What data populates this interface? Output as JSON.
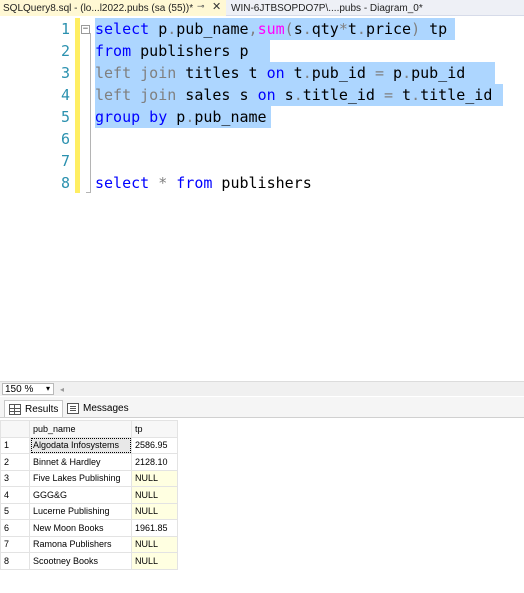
{
  "tabs": [
    {
      "label": "SQLQuery8.sql - (lo...l2022.pubs (sa (55))*",
      "pin": "⊸",
      "close": "✕",
      "active": true
    },
    {
      "label": "WIN-6JTBSOPDO7P\\....pubs - Diagram_0*",
      "active": false
    }
  ],
  "editor": {
    "line_numbers": [
      "1",
      "2",
      "3",
      "4",
      "5",
      "6",
      "7",
      "8"
    ],
    "fold_glyph": "−",
    "lines": [
      [
        {
          "t": "select",
          "c": "kw"
        },
        {
          "t": " p",
          "c": "tx"
        },
        {
          "t": ".",
          "c": "gr"
        },
        {
          "t": "pub_name",
          "c": "tx"
        },
        {
          "t": ",",
          "c": "gr"
        },
        {
          "t": "sum",
          "c": "fn"
        },
        {
          "t": "(",
          "c": "gr"
        },
        {
          "t": "s",
          "c": "tx"
        },
        {
          "t": ".",
          "c": "gr"
        },
        {
          "t": "qty",
          "c": "tx"
        },
        {
          "t": "*",
          "c": "gr"
        },
        {
          "t": "t",
          "c": "tx"
        },
        {
          "t": ".",
          "c": "gr"
        },
        {
          "t": "price",
          "c": "tx"
        },
        {
          "t": ")",
          "c": "gr"
        },
        {
          "t": " tp",
          "c": "tx"
        }
      ],
      [
        {
          "t": "from",
          "c": "kw"
        },
        {
          "t": " publishers p",
          "c": "tx"
        }
      ],
      [
        {
          "t": "left join",
          "c": "gr"
        },
        {
          "t": " titles t ",
          "c": "tx"
        },
        {
          "t": "on",
          "c": "kw"
        },
        {
          "t": " t",
          "c": "tx"
        },
        {
          "t": ".",
          "c": "gr"
        },
        {
          "t": "pub_id ",
          "c": "tx"
        },
        {
          "t": "=",
          "c": "gr"
        },
        {
          "t": " p",
          "c": "tx"
        },
        {
          "t": ".",
          "c": "gr"
        },
        {
          "t": "pub_id",
          "c": "tx"
        }
      ],
      [
        {
          "t": "left join",
          "c": "gr"
        },
        {
          "t": " sales s ",
          "c": "tx"
        },
        {
          "t": "on",
          "c": "kw"
        },
        {
          "t": " s",
          "c": "tx"
        },
        {
          "t": ".",
          "c": "gr"
        },
        {
          "t": "title_id ",
          "c": "tx"
        },
        {
          "t": "=",
          "c": "gr"
        },
        {
          "t": " t",
          "c": "tx"
        },
        {
          "t": ".",
          "c": "gr"
        },
        {
          "t": "title_id",
          "c": "tx"
        }
      ],
      [
        {
          "t": "group by",
          "c": "kw"
        },
        {
          "t": " p",
          "c": "tx"
        },
        {
          "t": ".",
          "c": "gr"
        },
        {
          "t": "pub_name",
          "c": "tx"
        }
      ],
      [],
      [],
      [
        {
          "t": "select",
          "c": "kw"
        },
        {
          "t": " ",
          "c": "tx"
        },
        {
          "t": "*",
          "c": "gr"
        },
        {
          "t": " ",
          "c": "tx"
        },
        {
          "t": "from",
          "c": "kw"
        },
        {
          "t": " publishers",
          "c": "tx"
        }
      ]
    ]
  },
  "zoom": {
    "value": "150 %",
    "arrow": "▾",
    "scroll_left": "◂"
  },
  "results_tabs": {
    "results_label": "Results",
    "messages_label": "Messages"
  },
  "results": {
    "columns": [
      "pub_name",
      "tp"
    ],
    "rows": [
      {
        "num": "1",
        "pub_name": "Algodata Infosystems",
        "tp": "2586.95"
      },
      {
        "num": "2",
        "pub_name": "Binnet & Hardley",
        "tp": "2128.10"
      },
      {
        "num": "3",
        "pub_name": "Five Lakes Publishing",
        "tp": "NULL"
      },
      {
        "num": "4",
        "pub_name": "GGG&G",
        "tp": "NULL"
      },
      {
        "num": "5",
        "pub_name": "Lucerne Publishing",
        "tp": "NULL"
      },
      {
        "num": "6",
        "pub_name": "New Moon Books",
        "tp": "1961.85"
      },
      {
        "num": "7",
        "pub_name": "Ramona Publishers",
        "tp": "NULL"
      },
      {
        "num": "8",
        "pub_name": "Scootney Books",
        "tp": "NULL"
      }
    ]
  }
}
